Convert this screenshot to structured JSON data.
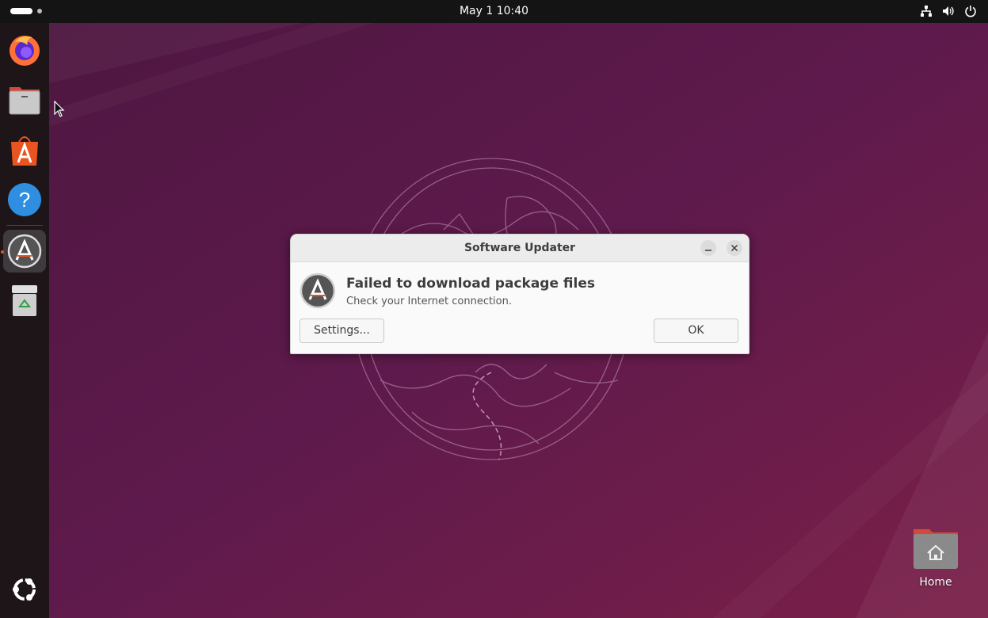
{
  "topbar": {
    "clock": "May 1  10:40",
    "tray_icons": [
      "network-icon",
      "volume-icon",
      "power-icon"
    ]
  },
  "dock": {
    "items": [
      {
        "name": "firefox",
        "icon": "firefox-icon"
      },
      {
        "name": "files",
        "icon": "files-icon"
      },
      {
        "name": "app-center",
        "icon": "app-center-icon"
      },
      {
        "name": "help",
        "icon": "help-icon"
      },
      {
        "name": "software-updater",
        "icon": "software-updater-icon",
        "active": true
      },
      {
        "name": "trash",
        "icon": "trash-icon"
      }
    ],
    "show_apps_icon": "ubuntu-logo-icon"
  },
  "dialog": {
    "title": "Software Updater",
    "heading": "Failed to download package files",
    "message": "Check your Internet connection.",
    "settings_label": "Settings...",
    "ok_label": "OK"
  },
  "desktop": {
    "home_label": "Home"
  },
  "colors": {
    "accent": "#e95420",
    "topbar": "#141414",
    "dock": "#1e1518",
    "wallpaper": "#5a1a4a"
  }
}
